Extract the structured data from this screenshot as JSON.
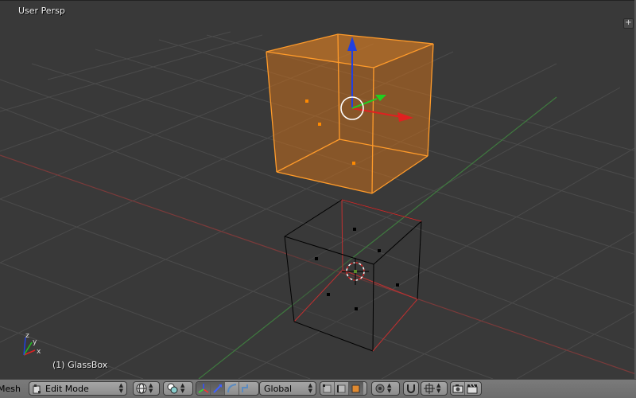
{
  "viewport": {
    "view_label": "User Persp",
    "object_label": "(1) GlassBox",
    "add_region_glyph": "+",
    "axis_labels": {
      "x": "x",
      "y": "y",
      "z": "z"
    }
  },
  "header": {
    "menu_mesh": "Mesh",
    "mode": {
      "value": "Edit Mode",
      "icon": "edit-mode-icon"
    },
    "orientation": {
      "value": "Global"
    },
    "selection_mode_active": "face"
  },
  "colors": {
    "background": "#393939",
    "grid": "#4a4a4a",
    "x_axis_line": "#7a3a3a",
    "y_axis_line": "#3f7a3f",
    "selected_mesh": "#ff9b2a",
    "selected_fill": "#c86f1e",
    "manipulator_x": "#e02020",
    "manipulator_y": "#20d020",
    "manipulator_z": "#2040e0"
  }
}
